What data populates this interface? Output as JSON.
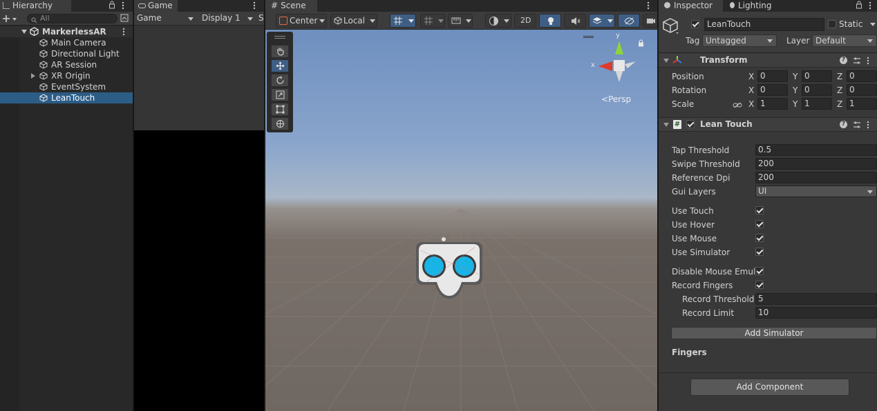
{
  "hierarchy": {
    "tab_label": "Hierarchy",
    "search_placeholder": "All",
    "scene_name": "MarkerlessAR",
    "items": [
      {
        "label": "Main Camera"
      },
      {
        "label": "Directional Light"
      },
      {
        "label": "AR Session"
      },
      {
        "label": "XR Origin"
      },
      {
        "label": "EventSystem"
      },
      {
        "label": "LeanTouch"
      }
    ],
    "selected": "LeanTouch"
  },
  "game": {
    "tab_label": "Game",
    "mode_label": "Game",
    "display_label": "Display 1",
    "truncated": "S"
  },
  "scene": {
    "tab_label": "Scene",
    "pivot_label": "Center",
    "space_label": "Local",
    "mode_2d": "2D",
    "persp_label": "Persp",
    "axis_x": "x",
    "axis_y": "y"
  },
  "inspector": {
    "tab_label": "Inspector",
    "lighting_tab_label": "Lighting",
    "object_name": "LeanTouch",
    "static_label": "Static",
    "tag_label": "Tag",
    "tag_value": "Untagged",
    "layer_label": "Layer",
    "layer_value": "Default",
    "transform": {
      "title": "Transform",
      "rows": [
        {
          "label": "Position",
          "x": "0",
          "y": "0",
          "z": "0"
        },
        {
          "label": "Rotation",
          "x": "0",
          "y": "0",
          "z": "0"
        },
        {
          "label": "Scale",
          "x": "1",
          "y": "1",
          "z": "1"
        }
      ],
      "axis_x": "X",
      "axis_y": "Y",
      "axis_z": "Z"
    },
    "lean_touch": {
      "title": "Lean Touch",
      "fields": [
        {
          "label": "Tap Threshold",
          "value": "0.5"
        },
        {
          "label": "Swipe Threshold",
          "value": "200"
        },
        {
          "label": "Reference Dpi",
          "value": "200"
        }
      ],
      "gui_layers_label": "Gui Layers",
      "gui_layers_value": "UI",
      "toggles": [
        {
          "label": "Use Touch",
          "checked": true
        },
        {
          "label": "Use Hover",
          "checked": true
        },
        {
          "label": "Use Mouse",
          "checked": true
        },
        {
          "label": "Use Simulator",
          "checked": true
        }
      ],
      "disable_mouse_label": "Disable Mouse Emula",
      "record_fingers_label": "Record Fingers",
      "record_threshold_label": "Record Threshold",
      "record_threshold_value": "5",
      "record_limit_label": "Record Limit",
      "record_limit_value": "10",
      "add_simulator_label": "Add Simulator",
      "fingers_label": "Fingers"
    },
    "add_component_label": "Add Component"
  }
}
